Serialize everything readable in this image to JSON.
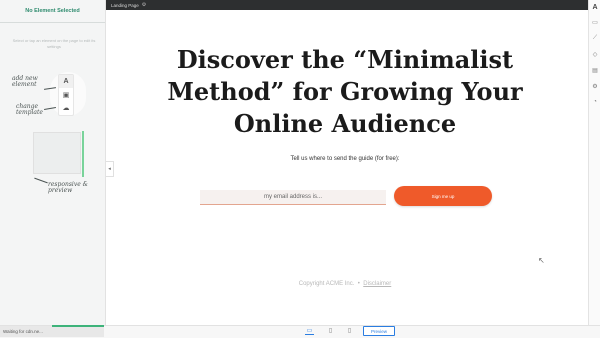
{
  "left_panel": {
    "title": "No Element Selected",
    "hint": "Select or tap an element on the page to edit its settings",
    "tools": [
      {
        "glyph": "A",
        "icon": "text-tool-icon"
      },
      {
        "glyph": "▣",
        "icon": "layout-icon"
      },
      {
        "glyph": "☁",
        "icon": "cloud-icon"
      }
    ],
    "annotations": {
      "add_new_element": "add new element",
      "change_template": "change template",
      "responsive_preview": "responsive & preview"
    },
    "collapse_glyph": "◂"
  },
  "top_bar": {
    "page_name": "Landing Page",
    "gear_glyph": "⚙"
  },
  "right_sidebar": {
    "icons": [
      {
        "glyph": "A",
        "icon": "text-style-icon"
      },
      {
        "glyph": "▭",
        "icon": "page-icon"
      },
      {
        "glyph": "⟋",
        "icon": "edit-icon"
      },
      {
        "glyph": "◇",
        "icon": "shape-icon"
      },
      {
        "glyph": "▤",
        "icon": "list-icon"
      },
      {
        "glyph": "⚙",
        "icon": "settings-icon"
      },
      {
        "glyph": "◔",
        "icon": "chart-icon"
      }
    ]
  },
  "canvas": {
    "headline": "Discover the “Minimalist Method” for Growing Your Online Audience",
    "subheading": "Tell us where to send the guide (for free):",
    "email_placeholder": "my email address is...",
    "signup_label": "Sign me up",
    "footer_copyright": "Copyright ACME Inc.",
    "footer_separator": "•",
    "footer_link": "Disclaimer",
    "cursor_glyph": "↖"
  },
  "bottom_bar": {
    "status_text": "Waiting for cdn.ne...",
    "devices": [
      {
        "glyph": "▭",
        "icon": "desktop-icon",
        "active": true
      },
      {
        "glyph": "▯",
        "icon": "tablet-icon",
        "active": false
      },
      {
        "glyph": "▯",
        "icon": "mobile-icon",
        "active": false
      }
    ],
    "preview_label": "Preview"
  },
  "colors": {
    "accent_green": "#2e8b6e",
    "cta_orange": "#ef5a2a",
    "preview_blue": "#2a7de1"
  }
}
